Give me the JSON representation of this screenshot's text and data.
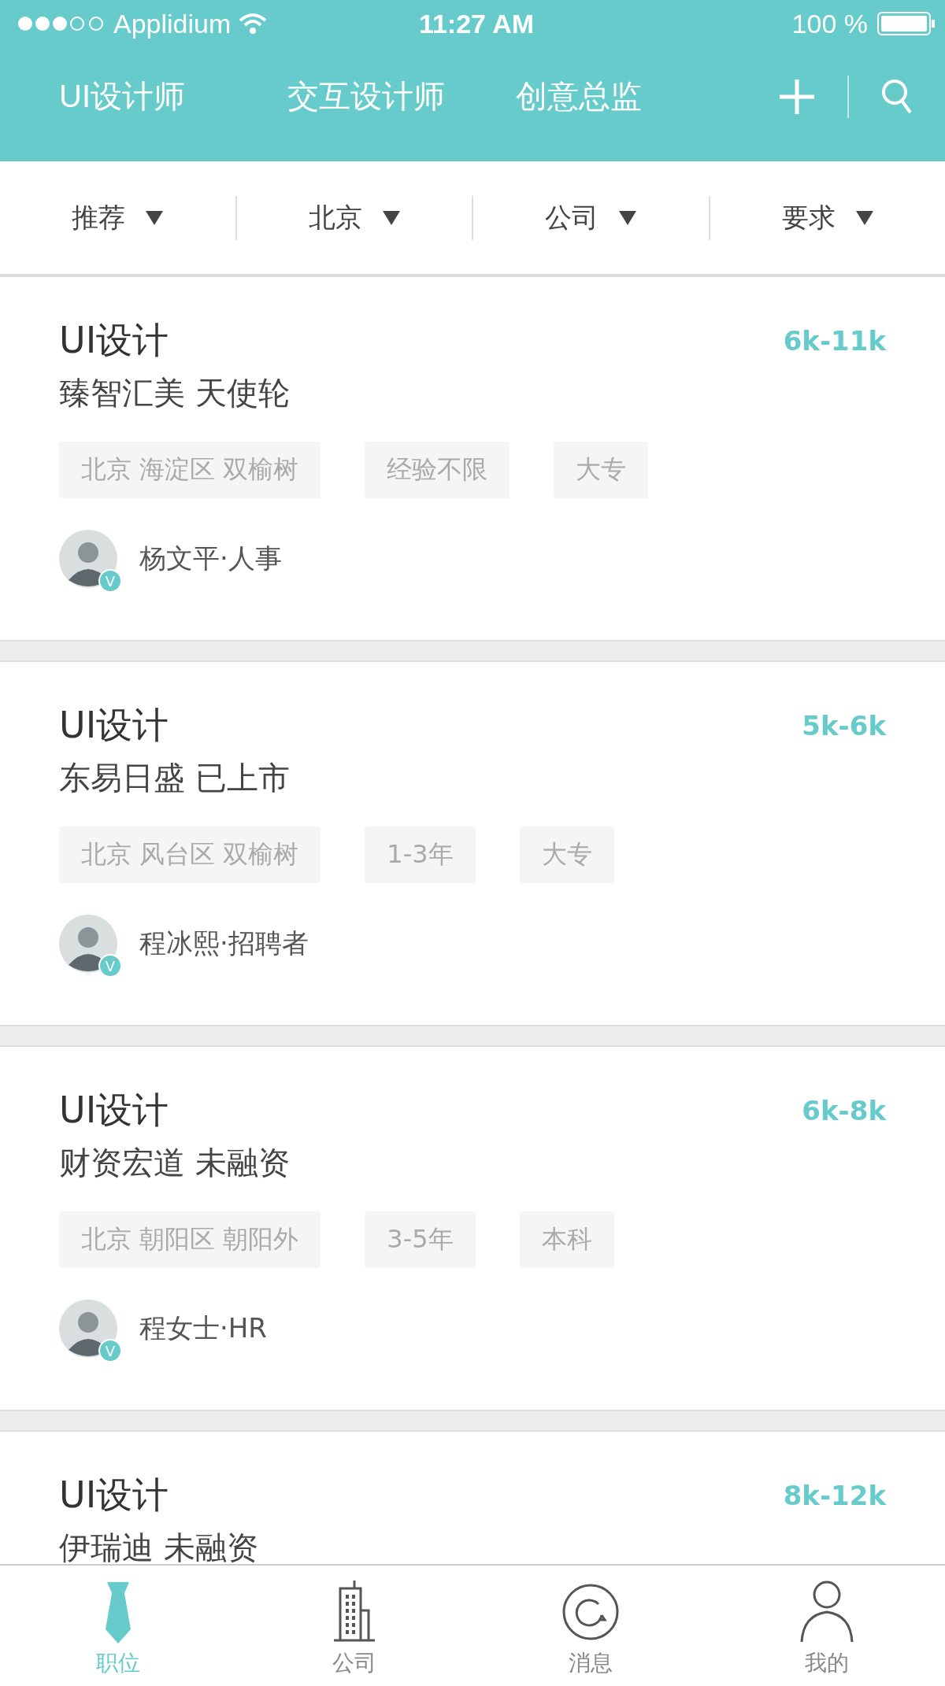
{
  "status_bar": {
    "carrier": "Applidium",
    "time": "11:27 AM",
    "battery": "100 %"
  },
  "header": {
    "tabs": [
      {
        "label": "UI设计师"
      },
      {
        "label": "交互设计师"
      },
      {
        "label": "创意总监"
      }
    ]
  },
  "filters": [
    {
      "label": "推荐"
    },
    {
      "label": "北京"
    },
    {
      "label": "公司"
    },
    {
      "label": "要求"
    }
  ],
  "jobs": [
    {
      "title": "UI设计",
      "salary": "6k-11k",
      "company": "臻智汇美 天使轮",
      "tags": [
        "北京 海淀区 双榆树",
        "经验不限",
        "大专"
      ],
      "recruiter": "杨文平·人事",
      "verified": true,
      "badge": "V"
    },
    {
      "title": "UI设计",
      "salary": "5k-6k",
      "company": "东易日盛 已上市",
      "tags": [
        "北京 风台区 双榆树",
        "1-3年",
        "大专"
      ],
      "recruiter": "程冰熙·招聘者",
      "verified": true,
      "badge": "V"
    },
    {
      "title": "UI设计",
      "salary": "6k-8k",
      "company": "财资宏道 未融资",
      "tags": [
        "北京 朝阳区 朝阳外",
        "3-5年",
        "本科"
      ],
      "recruiter": "程女士·HR",
      "verified": true,
      "badge": "V"
    },
    {
      "title": "UI设计",
      "salary": "8k-12k",
      "company": "伊瑞迪 未融资"
    }
  ],
  "tab_bar": [
    {
      "kind": "tie",
      "label": "职位",
      "selected": true
    },
    {
      "kind": "building",
      "label": "公司",
      "selected": false
    },
    {
      "kind": "chat",
      "label": "消息",
      "selected": false
    },
    {
      "kind": "person",
      "label": "我的",
      "selected": false
    }
  ]
}
